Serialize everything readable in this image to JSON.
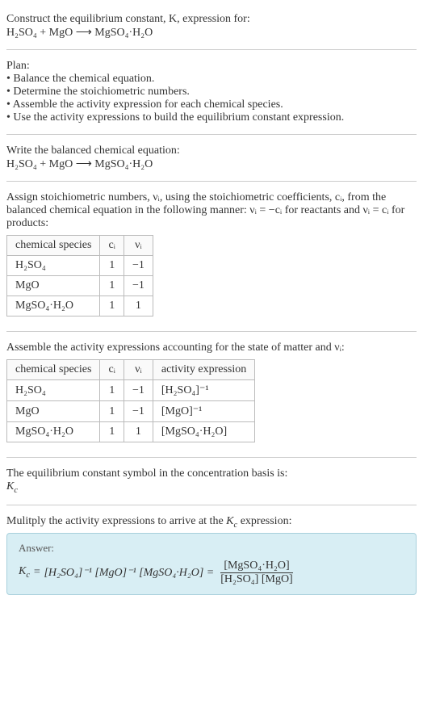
{
  "title": "Construct the equilibrium constant, K, expression for:",
  "equation": "H₂SO₄ + MgO ⟶ MgSO₄·H₂O",
  "plan_heading": "Plan:",
  "plan_items": [
    "• Balance the chemical equation.",
    "• Determine the stoichiometric numbers.",
    "• Assemble the activity expression for each chemical species.",
    "• Use the activity expressions to build the equilibrium constant expression."
  ],
  "balanced_heading": "Write the balanced chemical equation:",
  "balanced_equation": "H₂SO₄ + MgO ⟶ MgSO₄·H₂O",
  "stoich_intro": "Assign stoichiometric numbers, νᵢ, using the stoichiometric coefficients, cᵢ, from the balanced chemical equation in the following manner: νᵢ = −cᵢ for reactants and νᵢ = cᵢ for products:",
  "table1": {
    "headers": [
      "chemical species",
      "cᵢ",
      "νᵢ"
    ],
    "rows": [
      [
        "H₂SO₄",
        "1",
        "−1"
      ],
      [
        "MgO",
        "1",
        "−1"
      ],
      [
        "MgSO₄·H₂O",
        "1",
        "1"
      ]
    ]
  },
  "activity_intro": "Assemble the activity expressions accounting for the state of matter and νᵢ:",
  "table2": {
    "headers": [
      "chemical species",
      "cᵢ",
      "νᵢ",
      "activity expression"
    ],
    "rows": [
      [
        "H₂SO₄",
        "1",
        "−1",
        "[H₂SO₄]⁻¹"
      ],
      [
        "MgO",
        "1",
        "−1",
        "[MgO]⁻¹"
      ],
      [
        "MgSO₄·H₂O",
        "1",
        "1",
        "[MgSO₄·H₂O]"
      ]
    ]
  },
  "symbol_line": "The equilibrium constant symbol in the concentration basis is:",
  "symbol": "K_c",
  "multiply_line": "Mulitply the activity expressions to arrive at the K_c expression:",
  "answer_label": "Answer:",
  "kc_prefix": "K_c = ",
  "kc_terms": "[H₂SO₄]⁻¹ [MgO]⁻¹ [MgSO₄·H₂O] = ",
  "frac_num": "[MgSO₄·H₂O]",
  "frac_den": "[H₂SO₄] [MgO]",
  "chart_data": {
    "type": "table",
    "tables": [
      {
        "title": "Stoichiometric numbers",
        "columns": [
          "chemical species",
          "c_i",
          "ν_i"
        ],
        "rows": [
          {
            "chemical species": "H2SO4",
            "c_i": 1,
            "ν_i": -1
          },
          {
            "chemical species": "MgO",
            "c_i": 1,
            "ν_i": -1
          },
          {
            "chemical species": "MgSO4·H2O",
            "c_i": 1,
            "ν_i": 1
          }
        ]
      },
      {
        "title": "Activity expressions",
        "columns": [
          "chemical species",
          "c_i",
          "ν_i",
          "activity expression"
        ],
        "rows": [
          {
            "chemical species": "H2SO4",
            "c_i": 1,
            "ν_i": -1,
            "activity expression": "[H2SO4]^-1"
          },
          {
            "chemical species": "MgO",
            "c_i": 1,
            "ν_i": -1,
            "activity expression": "[MgO]^-1"
          },
          {
            "chemical species": "MgSO4·H2O",
            "c_i": 1,
            "ν_i": 1,
            "activity expression": "[MgSO4·H2O]"
          }
        ]
      }
    ]
  }
}
